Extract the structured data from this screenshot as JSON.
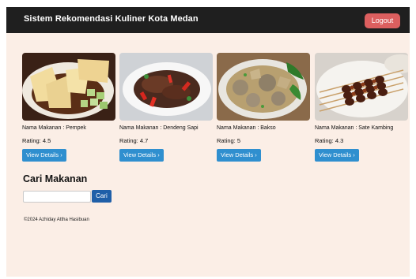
{
  "navbar": {
    "title": "Sistem Rekomendasi Kuliner Kota Medan",
    "logout_label": "Logout"
  },
  "cards": [
    {
      "name": "Nama Makanan : Pempek",
      "rating": "Rating: 4.5",
      "button": "View Details ›"
    },
    {
      "name": "Nama Makanan : Dendeng Sapi",
      "rating": "Rating: 4.7",
      "button": "View Details ›"
    },
    {
      "name": "Nama Makanan : Bakso",
      "rating": "Rating: 5",
      "button": "View Details ›"
    },
    {
      "name": "Nama Makanan : Sate Kambing",
      "rating": "Rating: 4.3",
      "button": "View Details ›"
    }
  ],
  "search": {
    "title": "Cari Makanan",
    "input_value": "",
    "button_label": "Cari"
  },
  "footer": {
    "text": "©2024 Azhiday Attha Hasibuan"
  },
  "colors": {
    "page_bg": "#fbeee6",
    "navbar_bg": "#1f1f1f",
    "logout_bg": "#dc5f5f",
    "details_btn": "#2f8fcf",
    "search_btn": "#1f5fa8"
  }
}
